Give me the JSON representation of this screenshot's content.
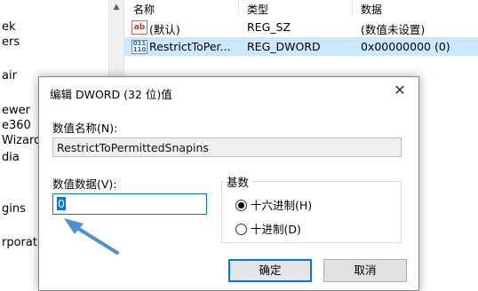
{
  "tree": {
    "items": [
      "ek",
      "ers",
      "air",
      "ewer",
      "e360",
      "Wizard",
      "dia",
      "gins",
      "rporati"
    ]
  },
  "values": {
    "headers": {
      "name": "名称",
      "type": "类型",
      "data": "数据"
    },
    "rows": [
      {
        "icon": "string-value-icon",
        "name": "(默认)",
        "type": "REG_SZ",
        "data": "(数值未设置)"
      },
      {
        "icon": "dword-value-icon",
        "name": "RestrictToPer...",
        "type": "REG_DWORD",
        "data": "0x00000000 (0)"
      }
    ]
  },
  "dialog": {
    "title": "编辑 DWORD (32 位)值",
    "name_label": "数值名称(N):",
    "name_value": "RestrictToPermittedSnapins",
    "value_label": "数值数据(V):",
    "value_value": "0",
    "base_label": "基数",
    "base_options": [
      {
        "label": "十六进制(H)",
        "selected": true
      },
      {
        "label": "十进制(D)",
        "selected": false
      }
    ],
    "ok_label": "确定",
    "cancel_label": "取消",
    "close_icon": "close-icon"
  },
  "colors": {
    "selection": "#cce8ff",
    "accent": "#0078d7",
    "arrow": "#4a90d9"
  }
}
